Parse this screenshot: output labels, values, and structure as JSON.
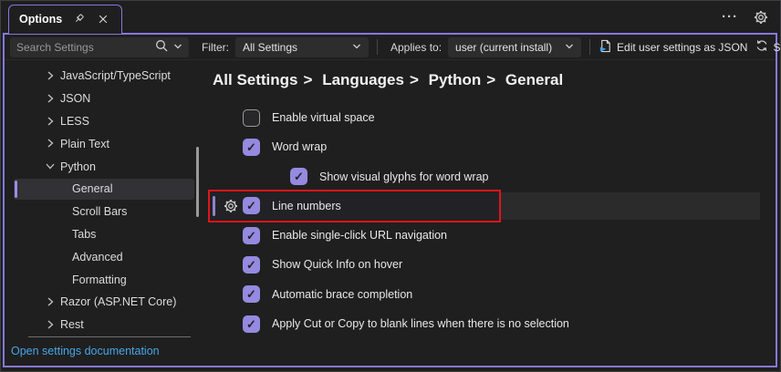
{
  "window": {
    "tab_label": "Options",
    "more_glyph": "···"
  },
  "toolbar": {
    "search_placeholder": "Search Settings",
    "filter_label": "Filter:",
    "filter_value": "All Settings",
    "applies_label": "Applies to:",
    "applies_value": "user (current install)",
    "edit_json_label": "Edit user settings as JSON",
    "sync_label": "Sync"
  },
  "sidebar": {
    "items": [
      {
        "label": "JavaScript/TypeScript",
        "state": "collapsed"
      },
      {
        "label": "JSON",
        "state": "collapsed"
      },
      {
        "label": "LESS",
        "state": "collapsed"
      },
      {
        "label": "Plain Text",
        "state": "collapsed"
      },
      {
        "label": "Python",
        "state": "expanded"
      },
      {
        "label": "General",
        "child": true,
        "selected": true
      },
      {
        "label": "Scroll Bars",
        "child": true
      },
      {
        "label": "Tabs",
        "child": true
      },
      {
        "label": "Advanced",
        "child": true
      },
      {
        "label": "Formatting",
        "child": true
      },
      {
        "label": "Razor (ASP.NET Core)",
        "state": "collapsed"
      },
      {
        "label": "Rest",
        "state": "collapsed"
      }
    ],
    "doc_link": "Open settings documentation"
  },
  "breadcrumb": {
    "separator": ">",
    "parts": [
      "All Settings",
      "Languages",
      "Python",
      "General"
    ]
  },
  "settings": {
    "items": [
      {
        "label": "Enable virtual space",
        "checked": false,
        "indent": 0
      },
      {
        "label": "Word wrap",
        "checked": true,
        "indent": 0
      },
      {
        "label": "Show visual glyphs for word wrap",
        "checked": true,
        "indent": 1
      },
      {
        "label": "Line numbers",
        "checked": true,
        "indent": 0,
        "highlighted": true,
        "has_gear": true
      },
      {
        "label": "Enable single-click URL navigation",
        "checked": true,
        "indent": 0
      },
      {
        "label": "Show Quick Info on hover",
        "checked": true,
        "indent": 0
      },
      {
        "label": "Automatic brace completion",
        "checked": true,
        "indent": 0
      },
      {
        "label": "Apply Cut or Copy to blank lines when there is no selection",
        "checked": true,
        "indent": 0
      }
    ]
  },
  "colors": {
    "accent_purple": "#8678dd",
    "checkbox_purple": "#948adf",
    "selection_accent": "#9a8ce8",
    "annotation_red": "#e0141c",
    "link_blue": "#46a6e8",
    "row_hover": "#2b2b2b",
    "background": "#1f1f1f"
  }
}
